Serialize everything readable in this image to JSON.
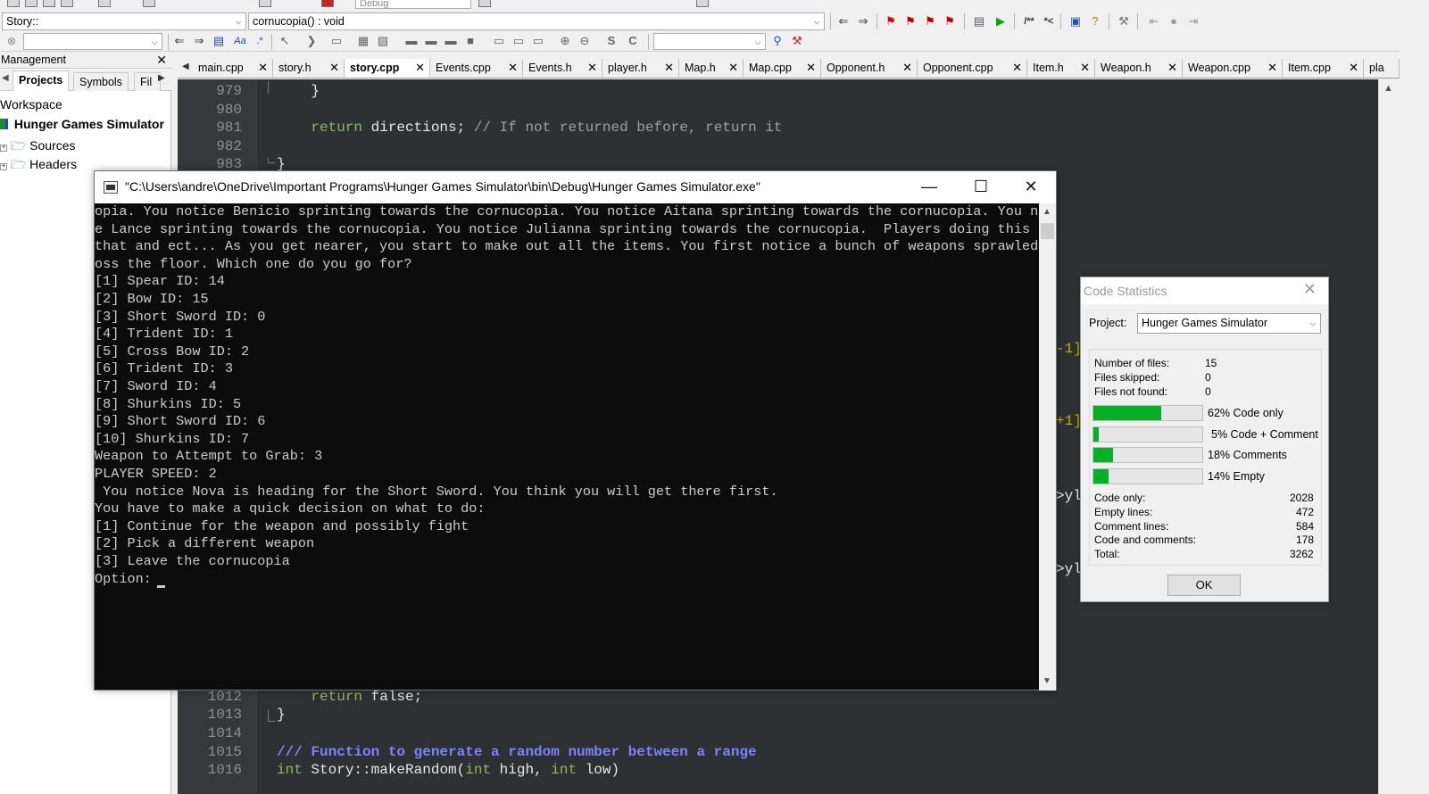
{
  "toolbar": {
    "scope_combo": "Story::",
    "function_combo": "cornucopia() : void",
    "build_target": "Debug",
    "search_value": "",
    "jump_value": ""
  },
  "management": {
    "title": "Management",
    "tabs": [
      {
        "label": "Projects"
      },
      {
        "label": "Symbols"
      },
      {
        "label": "Fil"
      }
    ],
    "tree": {
      "workspace": "Workspace",
      "project": "Hunger Games Simulator",
      "sources": "Sources",
      "headers": "Headers"
    }
  },
  "editor": {
    "tabs": [
      {
        "label": "main.cpp"
      },
      {
        "label": "story.h"
      },
      {
        "label": "story.cpp"
      },
      {
        "label": "Events.cpp"
      },
      {
        "label": "Events.h"
      },
      {
        "label": "player.h"
      },
      {
        "label": "Map.h"
      },
      {
        "label": "Map.cpp"
      },
      {
        "label": "Opponent.h"
      },
      {
        "label": "Opponent.cpp"
      },
      {
        "label": "Item.h"
      },
      {
        "label": "Weapon.h"
      },
      {
        "label": "Weapon.cpp"
      },
      {
        "label": "Item.cpp"
      },
      {
        "label": "pla"
      }
    ],
    "lines_top": [
      {
        "num": "979",
        "text": "    }"
      },
      {
        "num": "980",
        "text": ""
      },
      {
        "num": "981",
        "kw": "return",
        "rest": " directions; ",
        "comment": "// If not returned before, return it"
      },
      {
        "num": "982",
        "text": ""
      },
      {
        "num": "983",
        "text": "}"
      }
    ],
    "lines_bottom": [
      {
        "num": "1012",
        "kw": "return",
        "rest": " false;"
      },
      {
        "num": "1013",
        "text": "}"
      },
      {
        "num": "1014",
        "text": ""
      },
      {
        "num": "1015",
        "doc": "/// Function to generate a random number between a range"
      },
      {
        "num": "1016",
        "kw": "int",
        "rest": " Story::makeRandom(",
        "kw2": "int",
        "rest2": " high, ",
        "kw3": "int",
        "rest3": " low)"
      }
    ],
    "fragments": [
      "-1]",
      "+1]",
      ">yl",
      ">yl"
    ]
  },
  "console": {
    "title": "\"C:\\Users\\andre\\OneDrive\\Important Programs\\Hunger Games Simulator\\bin\\Debug\\Hunger Games Simulator.exe\"",
    "lines": [
      "opia. You notice Benicio sprinting towards the cornucopia. You notice Aitana sprinting towards the cornucopia. You notic",
      "e Lance sprinting towards the cornucopia. You notice Julianna sprinting towards the cornucopia.  Players doing this and",
      "that and ect... As you get nearer, you start to make out all the items. You first notice a bunch of weapons sprawled acr",
      "oss the floor. Which one do you go for?",
      "[1] Spear ID: 14",
      "[2] Bow ID: 15",
      "[3] Short Sword ID: 0",
      "[4] Trident ID: 1",
      "[5] Cross Bow ID: 2",
      "[6] Trident ID: 3",
      "[7] Sword ID: 4",
      "[8] Shurkins ID: 5",
      "[9] Short Sword ID: 6",
      "[10] Shurkins ID: 7",
      "Weapon to Attempt to Grab: 3",
      "PLAYER SPEED: 2",
      " You notice Nova is heading for the Short Sword. You think you will get there first.",
      "You have to make a quick decision on what to do:",
      "[1] Continue for the weapon and possibly fight",
      "[2] Pick a different weapon",
      "[3] Leave the cornucopia",
      "Option: "
    ]
  },
  "stats_dialog": {
    "title": "Code Statistics",
    "project_label": "Project:",
    "project_value": "Hunger Games Simulator",
    "files": [
      {
        "label": "Number of files:",
        "value": "15"
      },
      {
        "label": "Files skipped:",
        "value": "0"
      },
      {
        "label": "Files not found:",
        "value": "0"
      }
    ],
    "bars": [
      {
        "label": "62% Code only",
        "fraction": 0.62
      },
      {
        "label": "5% Code + Comment",
        "fraction": 0.05
      },
      {
        "label": "18% Comments",
        "fraction": 0.18
      },
      {
        "label": "14% Empty",
        "fraction": 0.14
      }
    ],
    "counts": [
      {
        "label": "Code only:",
        "value": "2028"
      },
      {
        "label": "Empty lines:",
        "value": "472"
      },
      {
        "label": "Comment lines:",
        "value": "584"
      },
      {
        "label": "Code and comments:",
        "value": "178"
      },
      {
        "label": "Total:",
        "value": "3262"
      }
    ],
    "ok_label": "OK",
    "bar_color": "#06b025"
  },
  "colors": {
    "editor_bg": "#2d3133",
    "console_bg": "#0c0c0c",
    "keyword": "#8fb660",
    "doc_comment": "#8080ff"
  }
}
